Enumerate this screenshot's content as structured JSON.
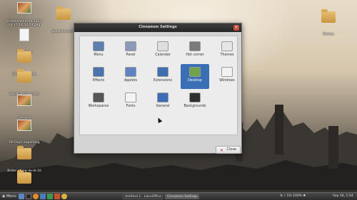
{
  "desktop": {
    "icons": [
      {
        "label": "Screenshot from 2013-10-15 14:54:59.png",
        "type": "image"
      },
      {
        "label": "TEST.png",
        "type": "doc"
      },
      {
        "label": "Dropbox Guide",
        "type": "folder"
      },
      {
        "label": "Desktop Organizer",
        "type": "folder"
      },
      {
        "label": "Tile.png",
        "type": "image"
      },
      {
        "label": "DP-Days Superblog",
        "type": "image"
      },
      {
        "label": "Bilder på pg-de-lö-10",
        "type": "folder"
      },
      {
        "label": "Resumes",
        "type": "folder"
      },
      {
        "label": "Speciel section",
        "type": "folder"
      },
      {
        "label": "Skriver",
        "type": "folder"
      }
    ]
  },
  "window": {
    "title": "Cinnamon Settings",
    "items": [
      {
        "label": "Menu",
        "icon": "menu-icon",
        "color": "#5d7fb0",
        "selected": false
      },
      {
        "label": "Panel",
        "icon": "panel-icon",
        "color": "#8a9ab8",
        "selected": false
      },
      {
        "label": "Calendar",
        "icon": "clock-icon",
        "color": "#dedede",
        "selected": false
      },
      {
        "label": "Hot corner",
        "icon": "hot-corner-icon",
        "color": "#7a7a7a",
        "selected": false
      },
      {
        "label": "Themes",
        "icon": "themes-icon",
        "color": "#e6e6e6",
        "selected": false
      },
      {
        "label": "Effects",
        "icon": "effects-icon",
        "color": "#4a74b0",
        "selected": false
      },
      {
        "label": "Applets",
        "icon": "applets-icon",
        "color": "#5f82c2",
        "selected": false
      },
      {
        "label": "Extensions",
        "icon": "extensions-icon",
        "color": "#3e6fb0",
        "selected": false
      },
      {
        "label": "Desktop",
        "icon": "desktop-icon",
        "color": "#6fa24a",
        "selected": true
      },
      {
        "label": "Windows",
        "icon": "windows-icon",
        "color": "#f2f2f2",
        "selected": false
      },
      {
        "label": "Workspaces",
        "icon": "workspaces-icon",
        "color": "#555555",
        "selected": false
      },
      {
        "label": "Fonts",
        "icon": "fonts-icon",
        "color": "#f4f4f4",
        "selected": false
      },
      {
        "label": "General",
        "icon": "general-icon",
        "color": "#3d6db6",
        "selected": false
      },
      {
        "label": "Backgrounds",
        "icon": "backgrounds-icon",
        "color": "#2f2f2f",
        "selected": false
      }
    ],
    "close_label": "Close"
  },
  "panel": {
    "menu_label": "Menu",
    "tasks": [
      {
        "label": "Untitled 2 - LibreOffice",
        "active": false
      },
      {
        "label": "Cinnamon Settings",
        "active": true
      }
    ],
    "clock": "Sep 18, 1:54",
    "tray_text": "1% 100%"
  },
  "colors": {
    "selection": "#3b6fb5",
    "titlebar": "#2e2e2e",
    "panel": "#333333"
  }
}
